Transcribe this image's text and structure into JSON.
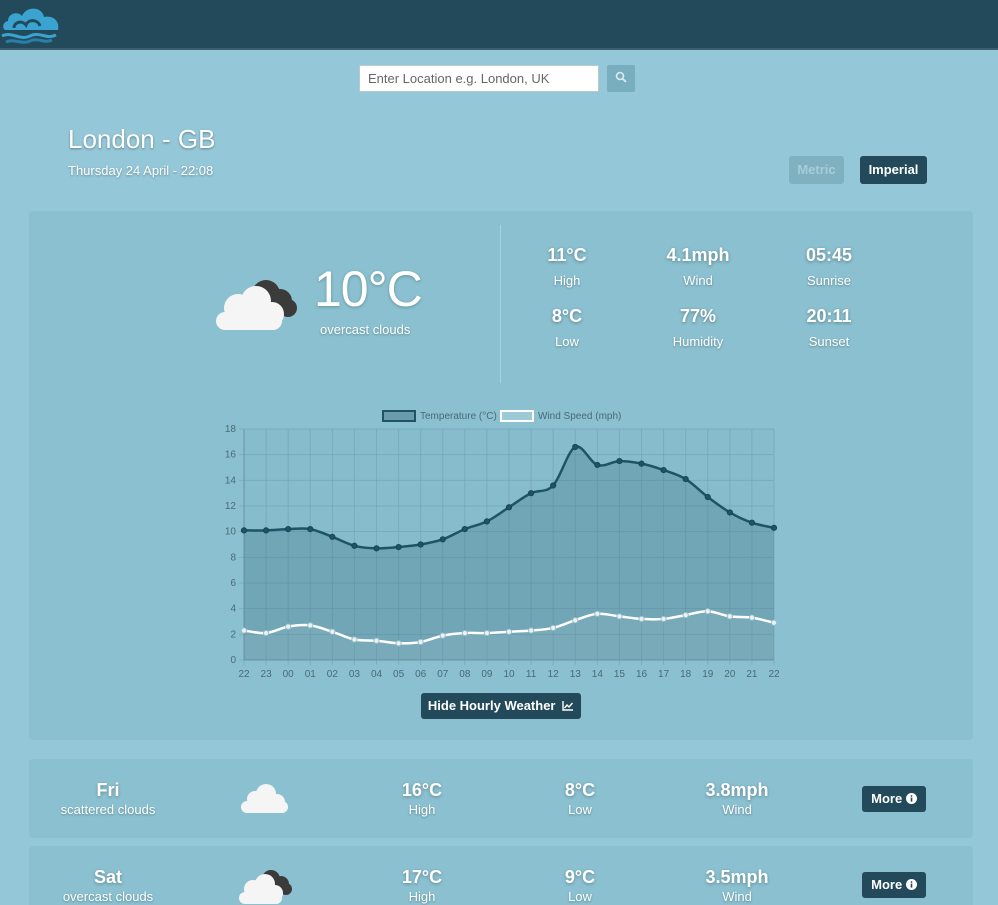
{
  "colors": {
    "topbar": "#234a5a",
    "background": "#94c7d8",
    "panel": "#8ac0d0",
    "accent_dark": "#234a5a",
    "temperature_line": "#1f5468",
    "wind_line": "#ffffff"
  },
  "header": {
    "logo_icon": "cloud-wave-logo"
  },
  "search": {
    "placeholder": "Enter Location e.g. London, UK",
    "value": "",
    "button_icon": "search-icon"
  },
  "location": {
    "name": "London - GB",
    "datetime": "Thursday 24 April - 22:08"
  },
  "units": {
    "metric_label": "Metric",
    "imperial_label": "Imperial",
    "selected": "Imperial"
  },
  "current": {
    "icon": "overcast-clouds-icon",
    "temperature": "10°C",
    "description": "overcast clouds",
    "stats": [
      {
        "value": "11°C",
        "label": "High"
      },
      {
        "value": "4.1mph",
        "label": "Wind"
      },
      {
        "value": "05:45",
        "label": "Sunrise"
      },
      {
        "value": "8°C",
        "label": "Low"
      },
      {
        "value": "77%",
        "label": "Humidity"
      },
      {
        "value": "20:11",
        "label": "Sunset"
      }
    ]
  },
  "chart_data": {
    "type": "line",
    "x": [
      "22",
      "23",
      "00",
      "01",
      "02",
      "03",
      "04",
      "05",
      "06",
      "07",
      "08",
      "09",
      "10",
      "11",
      "12",
      "13",
      "14",
      "15",
      "16",
      "17",
      "18",
      "19",
      "20",
      "21",
      "22"
    ],
    "series": [
      {
        "name": "Temperature (°C)",
        "values": [
          10.1,
          10.1,
          10.2,
          10.2,
          9.6,
          8.9,
          8.7,
          8.8,
          9.0,
          9.4,
          10.2,
          10.8,
          11.9,
          13.0,
          13.6,
          16.6,
          15.2,
          15.5,
          15.3,
          14.8,
          14.1,
          12.7,
          11.5,
          10.7,
          10.3
        ]
      },
      {
        "name": "Wind Speed (mph)",
        "values": [
          2.3,
          2.1,
          2.6,
          2.7,
          2.2,
          1.6,
          1.5,
          1.3,
          1.4,
          1.9,
          2.1,
          2.1,
          2.2,
          2.3,
          2.5,
          3.1,
          3.6,
          3.4,
          3.2,
          3.2,
          3.5,
          3.8,
          3.4,
          3.3,
          2.9
        ]
      }
    ],
    "ylim": [
      0,
      18
    ],
    "yticks": [
      0,
      2,
      4,
      6,
      8,
      10,
      12,
      14,
      16,
      18
    ],
    "grid": true,
    "legend_position": "top"
  },
  "hourly_toggle": {
    "label": "Hide Hourly Weather",
    "icon": "line-chart-icon"
  },
  "forecast": [
    {
      "day": "Fri",
      "description": "scattered clouds",
      "icon": "scattered-clouds-icon",
      "high": "16°C",
      "high_label": "High",
      "low": "8°C",
      "low_label": "Low",
      "wind": "3.8mph",
      "wind_label": "Wind",
      "more_label": "More"
    },
    {
      "day": "Sat",
      "description": "overcast clouds",
      "icon": "overcast-clouds-icon",
      "high": "17°C",
      "high_label": "High",
      "low": "9°C",
      "low_label": "Low",
      "wind": "3.5mph",
      "wind_label": "Wind",
      "more_label": "More"
    }
  ]
}
